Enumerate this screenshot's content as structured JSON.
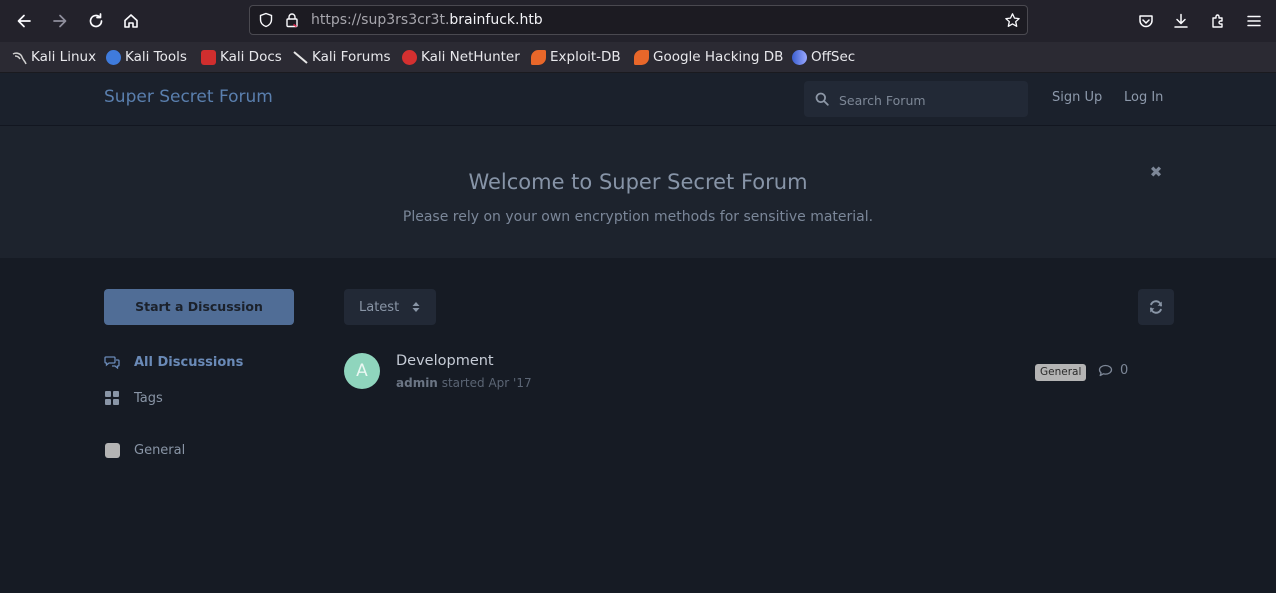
{
  "browser": {
    "url_scheme": "https://sup3rs3cr3t.",
    "url_domain": "brainfuck.htb",
    "bookmarks": [
      {
        "label": "Kali Linux",
        "icon": "kali-dragon-icon",
        "color": "#cccccc"
      },
      {
        "label": "Kali Tools",
        "icon": "kali-tools-icon",
        "color": "#3f7bdc"
      },
      {
        "label": "Kali Docs",
        "icon": "kali-docs-icon",
        "color": "#d02e2e"
      },
      {
        "label": "Kali Forums",
        "icon": "kali-forums-icon",
        "color": "#dddddd"
      },
      {
        "label": "Kali NetHunter",
        "icon": "nethunter-icon",
        "color": "#d43030"
      },
      {
        "label": "Exploit-DB",
        "icon": "exploit-db-icon",
        "color": "#e8672a"
      },
      {
        "label": "Google Hacking DB",
        "icon": "ghdb-icon",
        "color": "#e8672a"
      },
      {
        "label": "OffSec",
        "icon": "offsec-icon",
        "color": "#6a8ff0"
      }
    ]
  },
  "header": {
    "title": "Super Secret Forum",
    "search_placeholder": "Search Forum",
    "signup_label": "Sign Up",
    "login_label": "Log In"
  },
  "hero": {
    "title": "Welcome to Super Secret Forum",
    "subtitle": "Please rely on your own encryption methods for sensitive material.",
    "close_glyph": "✖"
  },
  "sidebar": {
    "start_label": "Start a Discussion",
    "nav": [
      {
        "label": "All Discussions",
        "icon": "comments-icon",
        "active": true
      },
      {
        "label": "Tags",
        "icon": "tags-grid-icon",
        "active": false
      }
    ],
    "tags": [
      {
        "label": "General",
        "color": "#b4b4b4"
      }
    ]
  },
  "toolbar": {
    "sort_label": "Latest"
  },
  "discussions": [
    {
      "avatar_letter": "A",
      "avatar_color": "#8fd5bd",
      "title": "Development",
      "author": "admin",
      "meta": "started Apr '17",
      "tag": "General",
      "replies": "0"
    }
  ],
  "colors": {
    "accent": "#5a7fae",
    "background": "#161b24",
    "header_bg": "#1b212c"
  }
}
